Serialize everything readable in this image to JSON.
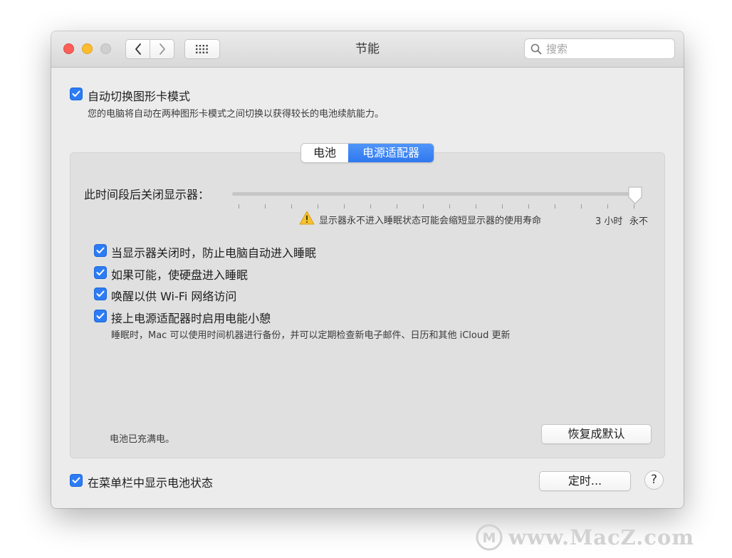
{
  "window": {
    "title": "节能"
  },
  "toolbar": {
    "search_placeholder": "搜索"
  },
  "graphics_switching": {
    "label": "自动切换图形卡模式",
    "checked": true,
    "description": "您的电脑将自动在两种图形卡模式之间切换以获得较长的电池续航能力。"
  },
  "tabs": [
    {
      "label": "电池",
      "selected": false
    },
    {
      "label": "电源适配器",
      "selected": true
    }
  ],
  "display_sleep": {
    "label": "此时间段后关闭显示器：",
    "level": 1.0,
    "warning": "显示器永不进入睡眠状态可能会缩短显示器的使用寿命",
    "tick_3h": "3 小时",
    "tick_never": "永不"
  },
  "options": [
    {
      "label": "当显示器关闭时，防止电脑自动进入睡眠",
      "checked": true
    },
    {
      "label": "如果可能，使硬盘进入睡眠",
      "checked": true
    },
    {
      "label": "唤醒以供 Wi-Fi 网络访问",
      "checked": true
    },
    {
      "label": "接上电源适配器时启用电能小憩",
      "checked": true
    }
  ],
  "power_nap_description": "睡眠时，Mac 可以使用时间机器进行备份，并可以定期检查新电子邮件、日历和其他 iCloud 更新",
  "battery_status": "电池已充满电。",
  "restore_defaults_button": "恢复成默认",
  "menubar_option": {
    "label": "在菜单栏中显示电池状态",
    "checked": true
  },
  "schedule_button": "定时...",
  "help_button": "?",
  "watermark": {
    "text": "www.MacZ.com",
    "logo": "M"
  }
}
